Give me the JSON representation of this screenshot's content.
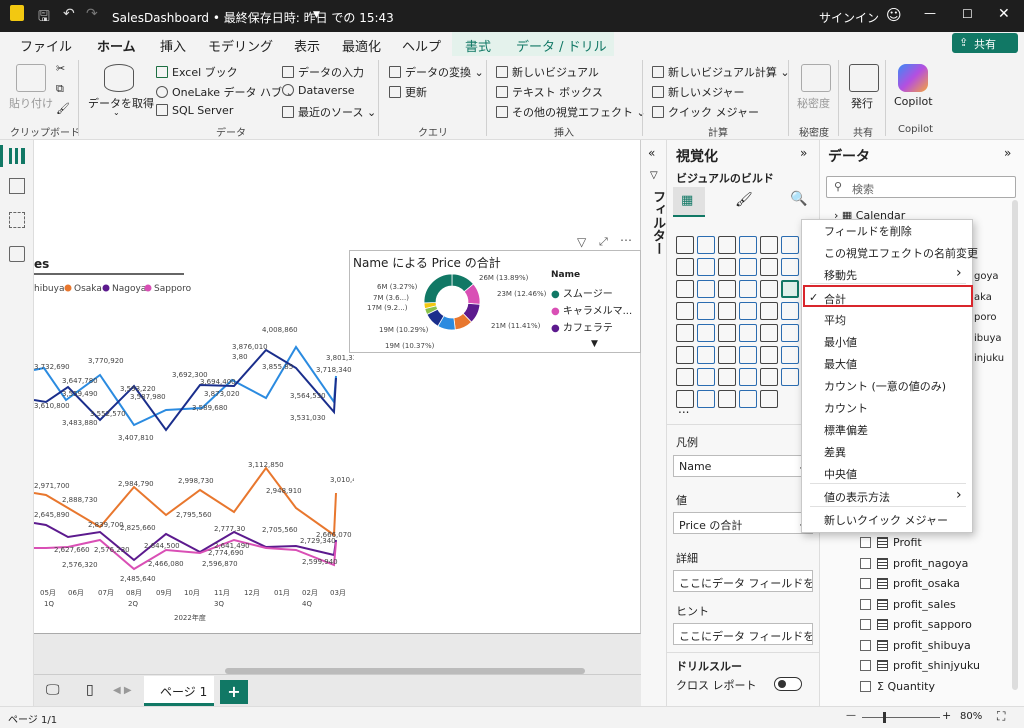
{
  "titlebar": {
    "doc_title": "SalesDashboard • 最終保存日時: 昨日 での 15:43",
    "signin": "サインイン"
  },
  "tabs": [
    "ファイル",
    "ホーム",
    "挿入",
    "モデリング",
    "表示",
    "最適化",
    "ヘルプ",
    "書式",
    "データ / ドリル"
  ],
  "share_label": "共有",
  "ribbon": {
    "paste": "貼り付け",
    "get_data": "データを取得",
    "excel": "Excel ブック",
    "onelake": "OneLake データ ハブ",
    "sql": "SQL Server",
    "enter_data": "データの入力",
    "dataverse": "Dataverse",
    "recent": "最近のソース",
    "transform": "データの変換",
    "refresh": "更新",
    "new_visual": "新しいビジュアル",
    "textbox": "テキスト ボックス",
    "more_visuals": "その他の視覚エフェクト",
    "new_visual_calc": "新しいビジュアル計算",
    "new_measure": "新しいメジャー",
    "quick_measure": "クイック メジャー",
    "sensitivity": "秘密度",
    "publish": "発行",
    "copilot": "Copilot",
    "groups": [
      "クリップボード",
      "データ",
      "クエリ",
      "挿入",
      "計算",
      "秘密度",
      "共有",
      "Copilot"
    ]
  },
  "canvas": {
    "linechart": {
      "title_fragment": "es",
      "legend": [
        "hibuya",
        "Osaka",
        "Nagoya",
        "Sapporo"
      ],
      "legend_colors": [
        "#e8772e",
        "#e8772e",
        "#5c1a8e",
        "#d94fb5"
      ],
      "months": [
        "05月",
        "06月",
        "07月",
        "08月",
        "09月",
        "10月",
        "11月",
        "12月",
        "01月",
        "02月",
        "03月"
      ],
      "quarters": [
        "1Q",
        "2Q",
        "3Q",
        "4Q"
      ],
      "fiscal_label": "2022年度",
      "upper_labels": [
        "3,732,690",
        "3,610,800",
        "3,647,780",
        "3,559,490",
        "3,483,880",
        "3,770,920",
        "3,552,570",
        "3,593,220",
        "3,587,980",
        "3,407,810",
        "3,692,300",
        "3,694,400",
        "3,873,020",
        "3,589,680",
        "3,876,010",
        "3,80",
        "3,855,85",
        "4,008,860",
        "3,564,530",
        "3,531,030",
        "3,801,330",
        "3,718,340"
      ],
      "lower_labels": [
        "2,971,700",
        "2,888,730",
        "2,984,790",
        "2,998,730",
        "3,112,850",
        "2,948,910",
        "3,010,460",
        "2,839,700",
        "2,825,660",
        "2,795,560",
        "2,777,30",
        "2,705,560",
        "2,666,070",
        "2,627,660",
        "2,645,890",
        "2,576,230",
        "2,644,500",
        "2,774,690",
        "2,641,490",
        "2,729,340",
        "2,576,320",
        "2,466,080",
        "2,596,870",
        "2,599,940",
        "2,485,640"
      ]
    },
    "donut": {
      "title": "Name による Price の合計",
      "legend_title": "Name",
      "legend": [
        "スムージー",
        "キャラメルマ...",
        "カフェラテ"
      ],
      "legend_colors": [
        "#117865",
        "#d94fb5",
        "#5c1a8e"
      ],
      "labels": [
        "26M (13.89%)",
        "23M (12.46%)",
        "21M (11.41%)",
        "19M (10.37%)",
        "19M (10.29%)",
        "17M (9.2...)",
        "7M (3.6...)",
        "6M (3.27%)"
      ]
    }
  },
  "chart_data": {
    "type": "pie",
    "title": "Name による Price の合計",
    "labels": [
      "スムージー",
      "キャラメルマ...",
      "カフェラテ"
    ],
    "slices_pct": [
      13.89,
      12.46,
      11.41,
      10.37,
      10.29,
      9.2,
      3.6,
      3.27
    ],
    "slices_value_label": [
      "26M",
      "23M",
      "21M",
      "19M",
      "19M",
      "17M",
      "7M",
      "6M"
    ]
  },
  "page_tab": "ページ 1",
  "add_page": "+",
  "status": {
    "page": "ページ 1/1",
    "zoom": "80%"
  },
  "filter_pane": {
    "label": "フィルター"
  },
  "viz_pane": {
    "title": "視覚化",
    "build": "ビジュアルのビルド",
    "legend_label": "凡例",
    "legend_field": "Name",
    "values_label": "値",
    "values_field": "Price の合計",
    "details_label": "詳細",
    "details_placeholder": "ここにデータ フィールドを...",
    "tooltip_label": "ヒント",
    "tooltip_placeholder": "ここにデータ フィールドを...",
    "drill_label": "ドリルスルー",
    "cross_report": "クロス レポート",
    "more": "..."
  },
  "data_pane": {
    "title": "データ",
    "search_placeholder": "検索",
    "table": "Calendar",
    "partial": [
      "goya",
      "aka",
      "poro",
      "ibuya",
      "injuku"
    ],
    "fields": [
      "Profit",
      "profit_nagoya",
      "profit_osaka",
      "profit_sales",
      "profit_sapporo",
      "profit_shibuya",
      "profit_shinjyuku",
      "Quantity"
    ]
  },
  "context_menu": {
    "items": [
      "フィールドを削除",
      "この視覚エフェクトの名前変更",
      "移動先",
      "合計",
      "平均",
      "最小値",
      "最大値",
      "カウント (一意の値のみ)",
      "カウント",
      "標準偏差",
      "差異",
      "中央値",
      "値の表示方法",
      "新しいクイック メジャー"
    ],
    "checked": "合計"
  }
}
